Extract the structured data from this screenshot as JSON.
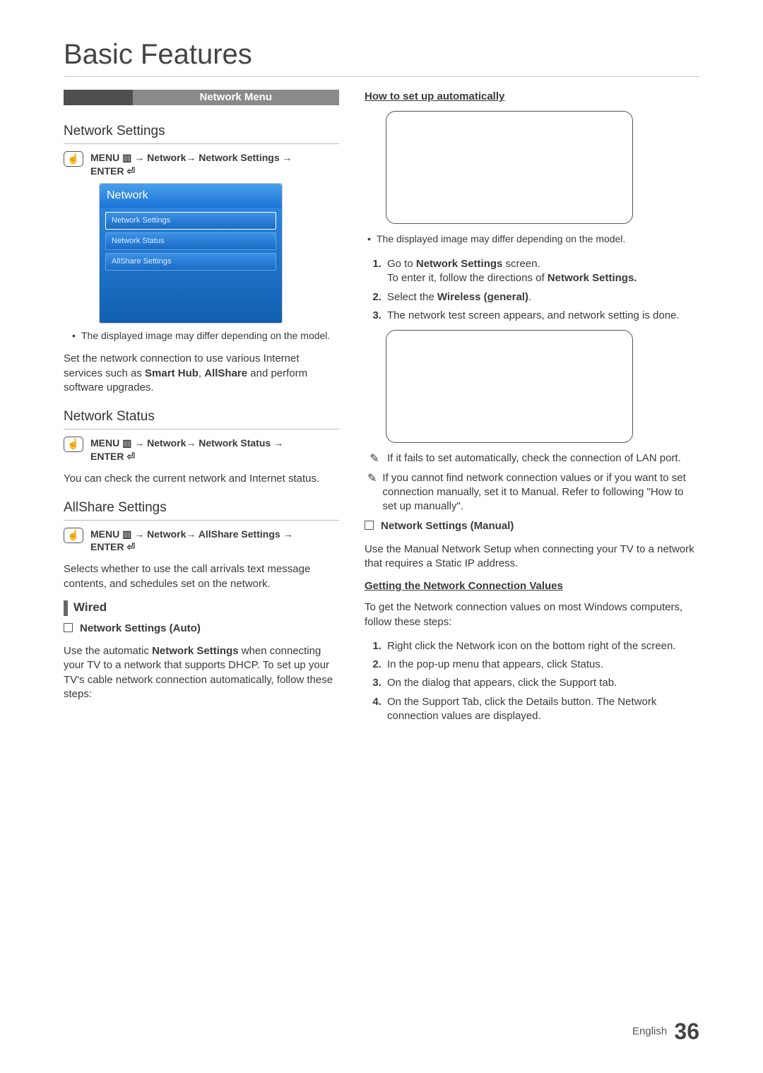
{
  "page_title": "Basic Features",
  "band": "Network Menu",
  "left": {
    "network_settings": {
      "heading": "Network Settings",
      "path_a": "MENU",
      "path_b": "→ Network→ Network Settings →",
      "path_c": "ENTER",
      "ui_title": "Network",
      "ui_items": [
        "Network Settings",
        "Network Status",
        "AllShare Settings"
      ],
      "note": "The displayed image may differ depending on the model.",
      "desc_a": "Set the network connection to use various Internet services such as ",
      "desc_b": "Smart Hub",
      "desc_c": ", ",
      "desc_d": "AllShare",
      "desc_e": " and perform software upgrades."
    },
    "network_status": {
      "heading": "Network Status",
      "path_a": "MENU",
      "path_b": "→ Network→ Network Status →",
      "path_c": "ENTER",
      "desc": "You can check the current network and Internet status."
    },
    "allshare": {
      "heading": "AllShare Settings",
      "path_a": "MENU",
      "path_b": "→ Network→ AllShare Settings →",
      "path_c": "ENTER",
      "desc": "Selects whether to use the call arrivals text message contents, and schedules set on the network."
    },
    "wired": {
      "heading": "Wired",
      "box_label": "Network Settings (Auto)",
      "desc_a": "Use the automatic ",
      "desc_b": "Network Settings",
      "desc_c": " when connecting your TV to a network that supports DHCP. To set up your TV's cable network connection automatically, follow these steps:"
    }
  },
  "right": {
    "auto_heading": "How to set up automatically",
    "note_model": "The displayed image may differ depending on the model.",
    "steps_auto": {
      "s1a": "Go to ",
      "s1b": "Network Settings",
      "s1c": " screen.",
      "s1_sub_a": "To enter it, follow the directions of ",
      "s1_sub_b": "Network Settings.",
      "s2a": "Select the ",
      "s2b": "Wireless (general)",
      "s2c": ".",
      "s3": "The network test screen appears, and network setting is done."
    },
    "tip1": "If it fails to set automatically, check the connection of LAN port.",
    "tip2": "If you cannot find network connection values or if you want to set connection manually, set it to Manual. Refer to following \"How to set up manually\".",
    "manual_box": "Network Settings (Manual)",
    "manual_desc": "Use the Manual Network Setup when connecting your TV to a network that requires a Static IP address.",
    "getting_heading": "Getting the Network Connection Values",
    "getting_desc": "To get the Network connection values on most Windows computers, follow these steps:",
    "steps_get": [
      "Right click the Network icon on the bottom right of the screen.",
      "In the pop-up menu that appears, click Status.",
      "On the dialog that appears, click the Support tab.",
      "On the Support Tab, click the Details button. The Network connection values are displayed."
    ]
  },
  "footer": {
    "lang": "English",
    "page": "36"
  }
}
